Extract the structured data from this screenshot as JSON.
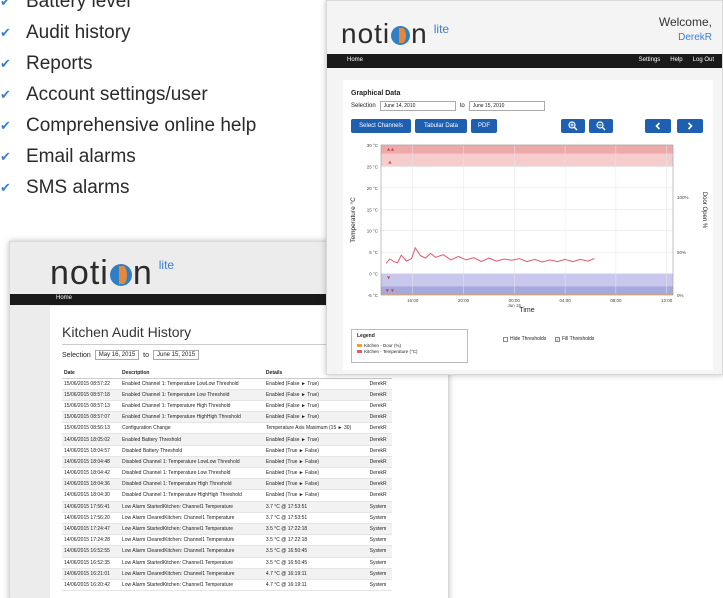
{
  "features": [
    "Battery level",
    "Audit history",
    "Reports",
    "Account settings/user",
    "Comprehensive online help",
    "Email alarms",
    "SMS alarms"
  ],
  "brand": {
    "name_pre": "noti",
    "name_post": "n",
    "suffix": "lite"
  },
  "chart_window": {
    "welcome": "Welcome,",
    "user": "DerekR",
    "nav_home": "Home",
    "nav_right": [
      "Settings",
      "Help",
      "Log Out"
    ],
    "title": "Graphical Data",
    "selection_label": "Selection",
    "from": "June 14, 2010",
    "to_label": "to",
    "to": "June 15, 2010",
    "buttons": {
      "channels": "Select Channels",
      "tabular": "Tabular Data",
      "pdf": "PDF"
    },
    "icons": {
      "zoom_in": "zoom-in-icon",
      "zoom_out": "zoom-out-icon",
      "prev": "chevron-left-icon",
      "next": "chevron-right-icon"
    },
    "legend_title": "Legend",
    "legend_items": [
      "Kitchen - Door (%)",
      "Kitchen - Temperature (°C)"
    ],
    "hide_thresholds": "Hide Thresholds",
    "fill_thresholds": "Fill Thresholds",
    "hide_thresholds_checked": false,
    "fill_thresholds_checked": true
  },
  "chart_data": {
    "type": "line",
    "xlabel": "Time",
    "ylabel": "Temperature °C",
    "y2label": "Door Open %",
    "ylim": [
      -5,
      30
    ],
    "y_ticks": [
      "30 °C",
      "25 °C",
      "20 °C",
      "15 °C",
      "10 °C",
      "5 °C",
      "0 °C",
      "-5 °C"
    ],
    "y2_ticks": [
      "100%",
      "50%",
      "0%"
    ],
    "x_ticks": [
      "16:00",
      "20:00",
      "00:00\nJun 15",
      "04:00",
      "08:00",
      "12:00"
    ],
    "thresholds": {
      "high": 25,
      "high_high": 28,
      "low": 0,
      "low_low": -3
    },
    "colors": {
      "temperature": "#e05a6a",
      "door": "#f0a030",
      "high_band": "#f6cccc",
      "low_band": "#c8c8ec"
    },
    "series": [
      {
        "name": "Kitchen - Temperature (°C)",
        "x": [
          13.9,
          14.2,
          14.5,
          14.8,
          15.1,
          15.5,
          15.9,
          16.2,
          16.6,
          17.0,
          17.4,
          17.8,
          18.4,
          19.0,
          19.6,
          20.2,
          20.8,
          21.4,
          22.0,
          22.6,
          23.2,
          23.8,
          24.4,
          25.0,
          25.6,
          26.2,
          26.8,
          27.4,
          28.0,
          28.6,
          29.2,
          29.8,
          30.3
        ],
        "values": [
          2.4,
          3.4,
          2.8,
          2.5,
          4.3,
          2.9,
          3.5,
          6.0,
          4.2,
          3.6,
          4.7,
          3.8,
          4.4,
          3.2,
          4.0,
          3.2,
          3.7,
          2.8,
          3.6,
          2.9,
          3.4,
          3.1,
          3.5,
          2.8,
          3.3,
          2.7,
          3.2,
          2.8,
          3.3,
          2.8,
          3.3,
          2.9,
          3.5
        ]
      }
    ]
  },
  "audit_window": {
    "nav_home": "Home",
    "title": "Kitchen Audit History",
    "selection_label": "Selection",
    "from": "May 16, 2015",
    "to_label": "to",
    "to": "June 15, 2015",
    "columns": [
      "Date",
      "Description",
      "Details",
      "User"
    ],
    "rows": [
      [
        "15/06/2015 08:57:22",
        "Enabled Channel 1: Temperature LowLow Threshold",
        "Enabled (False ► True)",
        "DerekR"
      ],
      [
        "15/06/2015 08:57:18",
        "Enabled Channel 1: Temperature Low Threshold",
        "Enabled (False ► True)",
        "DerekR"
      ],
      [
        "15/06/2015 08:57:13",
        "Enabled Channel 1: Temperature High Threshold",
        "Enabled (False ► True)",
        "DerekR"
      ],
      [
        "15/06/2015 08:57:07",
        "Enabled Channel 1: Temperature HighHigh Threshold",
        "Enabled (False ► True)",
        "DerekR"
      ],
      [
        "15/06/2015 08:56:13",
        "Configuration Change",
        "Temperature Axis Maximum (15 ► 30)",
        "DerekR"
      ],
      [
        "14/06/2015 18:05:02",
        "Enabled Battery Threshold",
        "Enabled (False ► True)",
        "DerekR"
      ],
      [
        "14/06/2015 18:04:57",
        "Disabled Battery Threshold",
        "Enabled (True ► False)",
        "DerekR"
      ],
      [
        "14/06/2015 18:04:48",
        "Disabled Channel 1: Temperature LowLow Threshold",
        "Enabled (True ► False)",
        "DerekR"
      ],
      [
        "14/06/2015 18:04:42",
        "Disabled Channel 1: Temperature Low Threshold",
        "Enabled (True ► False)",
        "DerekR"
      ],
      [
        "14/06/2015 18:04:36",
        "Disabled Channel 1: Temperature High Threshold",
        "Enabled (True ► False)",
        "DerekR"
      ],
      [
        "14/06/2015 18:04:30",
        "Disabled Channel 1: Temperature HighHigh Threshold",
        "Enabled (True ► False)",
        "DerekR"
      ],
      [
        "14/06/2015 17:56:41",
        "Low Alarm StartedKitchen: Channel1 Temperature",
        "3.7 °C @ 17:53:51",
        "System"
      ],
      [
        "14/06/2015 17:56:20",
        "Low Alarm ClearedKitchen: Channel1 Temperature",
        "3.7 °C @ 17:53:51",
        "System"
      ],
      [
        "14/06/2015 17:24:47",
        "Low Alarm StartedKitchen: Channel1 Temperature",
        "3.5 °C @ 17:22:18",
        "System"
      ],
      [
        "14/06/2015 17:24:28",
        "Low Alarm ClearedKitchen: Channel1 Temperature",
        "3.5 °C @ 17:22:18",
        "System"
      ],
      [
        "14/06/2015 16:52:55",
        "Low Alarm ClearedKitchen: Channel1 Temperature",
        "3.5 °C @ 16:50:45",
        "System"
      ],
      [
        "14/06/2015 16:52:35",
        "Low Alarm StartedKitchen: Channel1 Temperature",
        "3.5 °C @ 16:50:45",
        "System"
      ],
      [
        "14/06/2015 16:21:01",
        "Low Alarm ClearedKitchen: Channel1 Temperature",
        "4.7 °C @ 16:19:11",
        "System"
      ],
      [
        "14/06/2015 16:20:42",
        "Low Alarm StartedKitchen: Channel1 Temperature",
        "4.7 °C @ 16:19:11",
        "System"
      ]
    ]
  }
}
